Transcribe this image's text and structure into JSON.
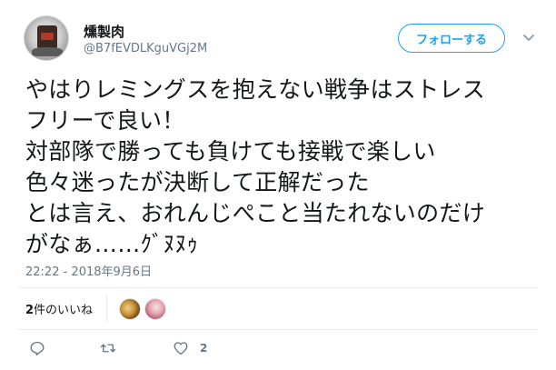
{
  "user": {
    "display_name": "燻製肉",
    "screen_name": "@B7fEVDLKguVGj2M"
  },
  "follow_button": {
    "label": "フォローする"
  },
  "tweet": {
    "text": "やはりレミングスを抱えない戦争はストレス\nフリーで良い！\n対部隊で勝っても負けても接戦で楽しい\n色々迷ったが決断して正解だった\nとは言え、おれんじぺこと当たれないのだけ\nがなぁ……ｸﾞﾇﾇｩ",
    "timestamp": "22:22 - 2018年9月6日"
  },
  "likes": {
    "count": "2",
    "label": "件のいいね"
  },
  "actions": {
    "reply_icon": "reply-icon",
    "retweet_icon": "retweet-icon",
    "like_icon": "heart-icon",
    "like_count": "2"
  },
  "colors": {
    "accent": "#1da1f2",
    "secondary_text": "#657786",
    "divider": "#e6ecf0"
  }
}
